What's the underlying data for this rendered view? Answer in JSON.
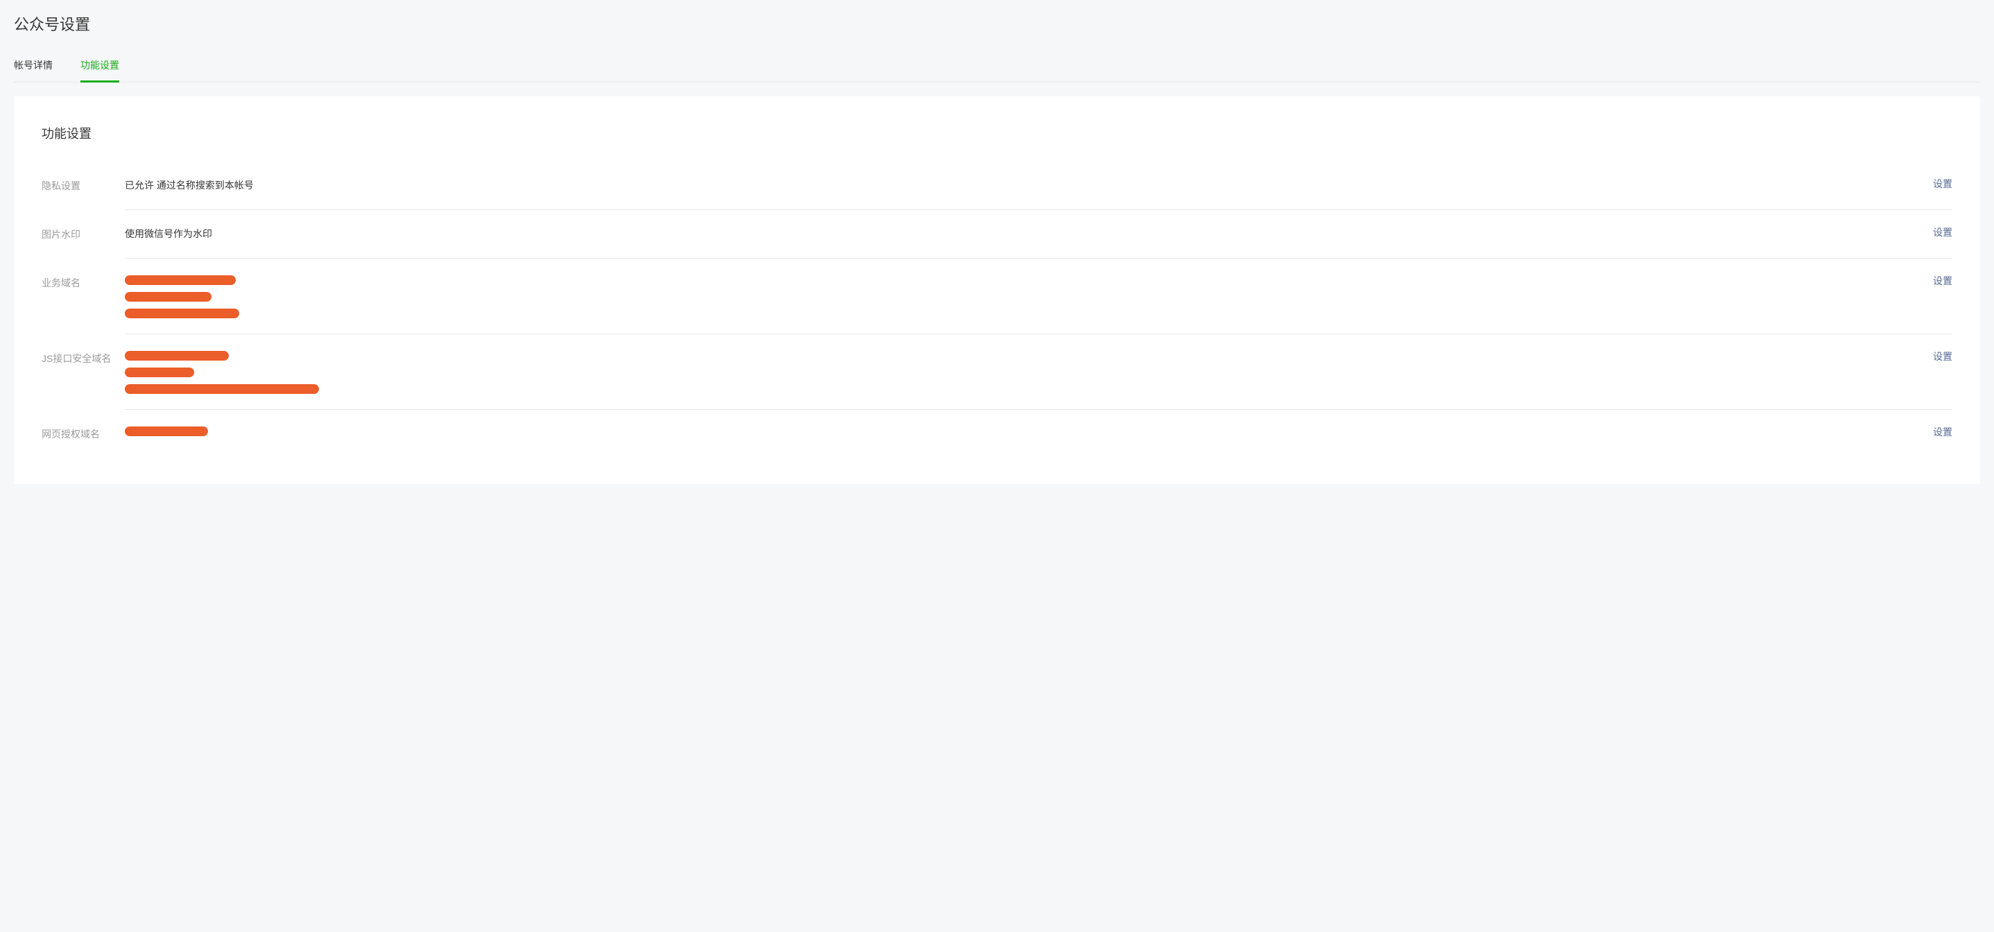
{
  "header": {
    "title": "公众号设置"
  },
  "tabs": [
    {
      "label": "帐号详情",
      "active": false
    },
    {
      "label": "功能设置",
      "active": true
    }
  ],
  "section": {
    "title": "功能设置",
    "action_label": "设置",
    "rows": [
      {
        "label": "隐私设置",
        "value": "已允许 通过名称搜索到本帐号",
        "redacted": []
      },
      {
        "label": "图片水印",
        "value": "使用微信号作为水印",
        "redacted": []
      },
      {
        "label": "业务域名",
        "value": "",
        "redacted": [
          160,
          125,
          165
        ]
      },
      {
        "label": "JS接口安全域名",
        "value": "",
        "redacted": [
          150,
          100,
          280
        ]
      },
      {
        "label": "网页授权域名",
        "value": "",
        "redacted": [
          120
        ]
      }
    ]
  }
}
